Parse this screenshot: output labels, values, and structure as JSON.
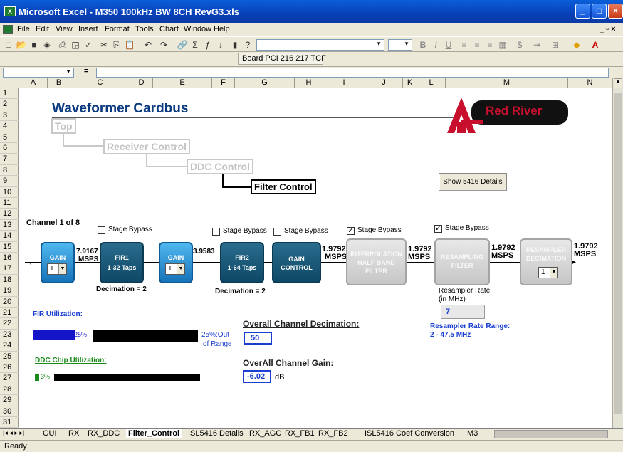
{
  "window": {
    "title": "Microsoft Excel - M350 100kHz BW 8CH RevG3.xls"
  },
  "menu": [
    "File",
    "Edit",
    "View",
    "Insert",
    "Format",
    "Tools",
    "Chart",
    "Window",
    "Help"
  ],
  "toolbar2": {
    "items": "Board  PCI  216  217  TCF"
  },
  "formula": {
    "cell_ref": "",
    "equals": "="
  },
  "columns": [
    "A",
    "B",
    "C",
    "D",
    "E",
    "F",
    "G",
    "H",
    "I",
    "J",
    "K",
    "L",
    "M",
    "N"
  ],
  "rows": [
    "1",
    "2",
    "3",
    "4",
    "5",
    "6",
    "7",
    "8",
    "9",
    "10",
    "11",
    "12",
    "13",
    "14",
    "15",
    "16",
    "17",
    "18",
    "19",
    "20",
    "21",
    "22",
    "23",
    "24",
    "25",
    "26",
    "27",
    "28",
    "29",
    "30",
    "31"
  ],
  "sheet": {
    "title": "Waveformer Cardbus",
    "logo_text": "Red River",
    "nav": {
      "top": "Top",
      "receiver": "Receiver Control",
      "ddc": "DDC Control",
      "filter": "Filter Control"
    },
    "show_details": "Show 5416 Details",
    "channel": "Channel 1 of 8",
    "bypass": [
      "Stage Bypass",
      "Stage Bypass",
      "Stage Bypass",
      "Stage Bypass",
      "Stage Bypass"
    ],
    "bypass_checked": [
      false,
      false,
      false,
      true,
      true
    ],
    "blocks": {
      "gain1": "GAIN",
      "gain1_val": "1",
      "fir1_a": "FIR1",
      "fir1_b": "1-32 Taps",
      "gain2": "GAIN",
      "gain2_val": "1",
      "fir2_a": "FIR2",
      "fir2_b": "1-64 Taps",
      "gainctl_a": "GAIN",
      "gainctl_b": "CONTROL",
      "interp_a": "INTERPOLATION",
      "interp_b": "HALF BAND",
      "interp_c": "FILTER",
      "resamp_a": "RESAMPLING",
      "resamp_b": "FILTER",
      "resdec_a": "RESAMPLER",
      "resdec_b": "DECIMATION",
      "resdec_val": "1"
    },
    "rates": {
      "r1a": "7.9167",
      "r1b": "MSPS",
      "r2": "3.9583",
      "r3a": "1.9792",
      "r3b": "MSPS",
      "r4a": "1.9792",
      "r4b": "MSPS",
      "r5a": "1.9792",
      "r5b": "MSPS",
      "r6a": "1.9792",
      "r6b": "MSPS"
    },
    "decimation1": "Decimation = 2",
    "decimation2": "Decimation = 2",
    "resampler_rate_label_a": "Resampler Rate",
    "resampler_rate_label_b": "(in MHz)",
    "resampler_rate_value": "7",
    "resampler_range_a": "Resampler Rate Range:",
    "resampler_range_b": "2 - 47.5 MHz",
    "fir_util_label": "FIR Utilization:",
    "fir_util_pct": "25%",
    "fir_util_fraction": 0.25,
    "fir_out_a": "25%:Out",
    "fir_out_b": "of Range",
    "ddc_util_label": "DDC Chip Utilization:",
    "ddc_util_pct": "3%",
    "ddc_util_fraction": 0.03,
    "overall_decim_label": "Overall Channel Decimation:",
    "overall_decim_value": "50",
    "overall_gain_label": "OverAll Channel Gain:",
    "overall_gain_value": "-6.02",
    "overall_gain_unit": "dB"
  },
  "tabs": [
    "GUI",
    "RX",
    "RX_DDC",
    "Filter_Control",
    "ISL5416 Details",
    "RX_AGC",
    "RX_FB1",
    "RX_FB2",
    "ISL5416 Coef Conversion",
    "M3"
  ],
  "status": "Ready",
  "colors": {
    "title_blue": "#0b3a80",
    "accent_red": "#c8102e",
    "link_blue": "#1a3fd0",
    "util_green": "#1a8a1a"
  }
}
